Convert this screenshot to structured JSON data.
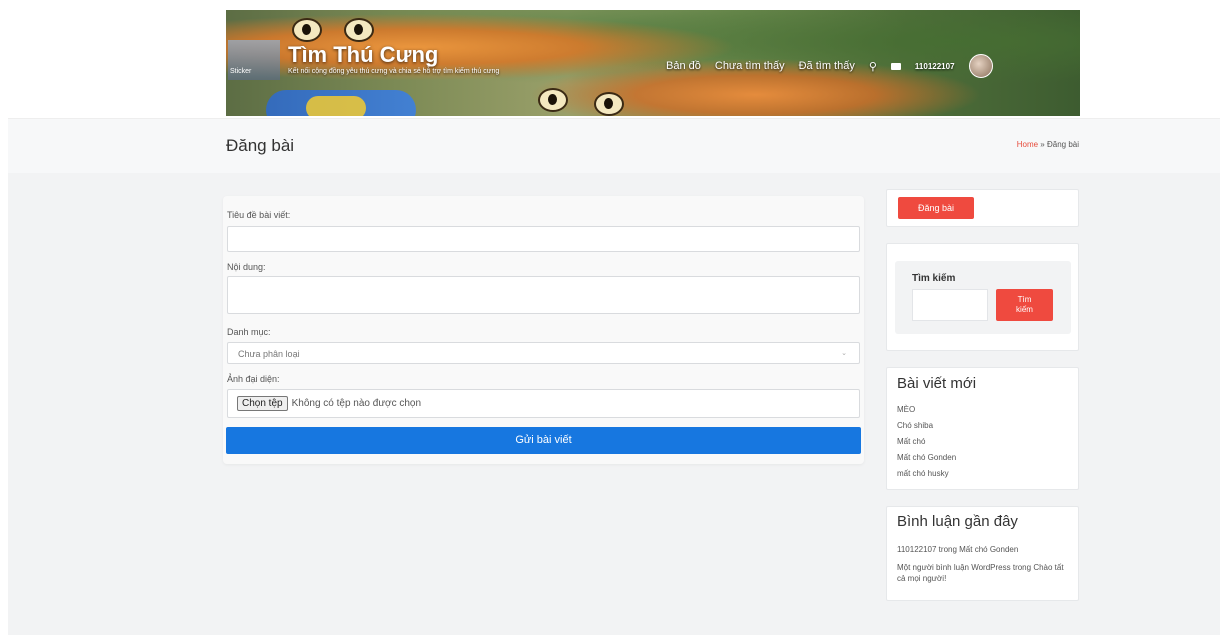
{
  "header": {
    "site_title": "Tìm Thú Cưng",
    "site_description": "Kết nối cộng đồng yêu thú cưng và chia sẻ hỗ trợ tìm kiếm thú cưng",
    "nav": [
      {
        "label": "Bản đồ"
      },
      {
        "label": "Chưa tìm thấy"
      },
      {
        "label": "Đã tìm thấy"
      }
    ],
    "username": "110122107",
    "icons": [
      "search-icon",
      "mail-icon",
      "avatar"
    ]
  },
  "page": {
    "title": "Đăng bài",
    "breadcrumb_home": "Home",
    "breadcrumb_sep": " » ",
    "breadcrumb_current": "Đăng bài"
  },
  "form": {
    "title_label": "Tiêu đề bài viết:",
    "title_value": "",
    "content_label": "Nội dung:",
    "content_value": "",
    "category_label": "Danh mục:",
    "category_selected": "Chưa phân loại",
    "image_label": "Ảnh đại diện:",
    "file_button": "Chọn tệp",
    "file_status": "Không có tệp nào được chọn",
    "submit_label": "Gửi bài viết"
  },
  "sidebar": {
    "post_button": "Đăng bài",
    "search_label": "Tìm kiếm",
    "search_button_line1": "Tìm",
    "search_button_line2": "kiếm",
    "recent_posts_title": "Bài viết mới",
    "recent_posts": [
      "MÈO",
      "Chó shiba",
      "Mất chó",
      "Mất chó Gonden",
      "mất chó husky"
    ],
    "recent_comments_title": "Bình luận gần đây",
    "comment1_author": "110122107",
    "comment1_mid": " trong ",
    "comment1_post": "Mất chó Gonden",
    "comment2_author": "Một người bình luận WordPress",
    "comment2_mid": " trong ",
    "comment2_post": "Chào tất cả mọi người!"
  },
  "colors": {
    "accent_red": "#ef4a3f",
    "submit_blue": "#1777e0"
  }
}
